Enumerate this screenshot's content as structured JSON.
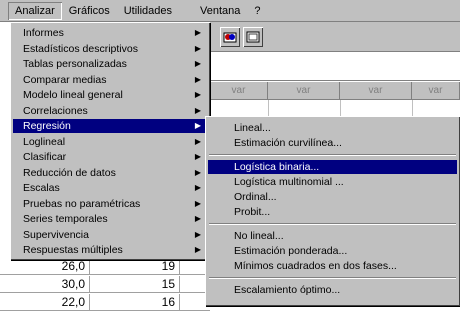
{
  "menubar": {
    "items": [
      "Analizar",
      "Gráficos",
      "Utilidades",
      "Ventana",
      "?"
    ]
  },
  "sheet": {
    "toolbar_icons": [
      "chart-icon",
      "window-icon"
    ],
    "col_headers": [
      "var",
      "var",
      "var",
      "var"
    ]
  },
  "data_rows": [
    {
      "a": "26,0",
      "b": "19"
    },
    {
      "a": "30,0",
      "b": "15"
    },
    {
      "a": "22,0",
      "b": "16"
    }
  ],
  "analizar_menu": {
    "items": [
      {
        "label": "Informes",
        "submenu": true
      },
      {
        "label": "Estadísticos descriptivos",
        "submenu": true
      },
      {
        "label": "Tablas personalizadas",
        "submenu": true
      },
      {
        "label": "Comparar medias",
        "submenu": true
      },
      {
        "label": "Modelo lineal general",
        "submenu": true
      },
      {
        "label": "Correlaciones",
        "submenu": true
      },
      {
        "label": "Regresión",
        "submenu": true,
        "highlighted": true
      },
      {
        "label": "Loglineal",
        "submenu": true
      },
      {
        "label": "Clasificar",
        "submenu": true
      },
      {
        "label": "Reducción de datos",
        "submenu": true
      },
      {
        "label": "Escalas",
        "submenu": true
      },
      {
        "label": "Pruebas no paramétricas",
        "submenu": true
      },
      {
        "label": "Series temporales",
        "submenu": true
      },
      {
        "label": "Supervivencia",
        "submenu": true
      },
      {
        "label": "Respuestas múltiples",
        "submenu": true
      }
    ]
  },
  "regresion_submenu": {
    "items": [
      {
        "label": "Lineal...",
        "highlighted": false
      },
      {
        "label": "Estimación curvilínea...",
        "highlighted": false
      },
      {
        "separator": true
      },
      {
        "label": "Logística binaria...",
        "highlighted": true
      },
      {
        "label": "Logística multinomial ...",
        "highlighted": false
      },
      {
        "label": "Ordinal...",
        "highlighted": false
      },
      {
        "label": "Probit...",
        "highlighted": false
      },
      {
        "separator": true
      },
      {
        "label": "No lineal...",
        "highlighted": false
      },
      {
        "label": "Estimación ponderada...",
        "highlighted": false
      },
      {
        "label": "Mínimos cuadrados en dos fases...",
        "highlighted": false
      },
      {
        "separator": true
      },
      {
        "label": "Escalamiento óptimo...",
        "highlighted": false
      }
    ]
  },
  "colors": {
    "menu_bg": "#c0c0c0",
    "highlight": "#000080",
    "highlight_text": "#ffffff"
  }
}
